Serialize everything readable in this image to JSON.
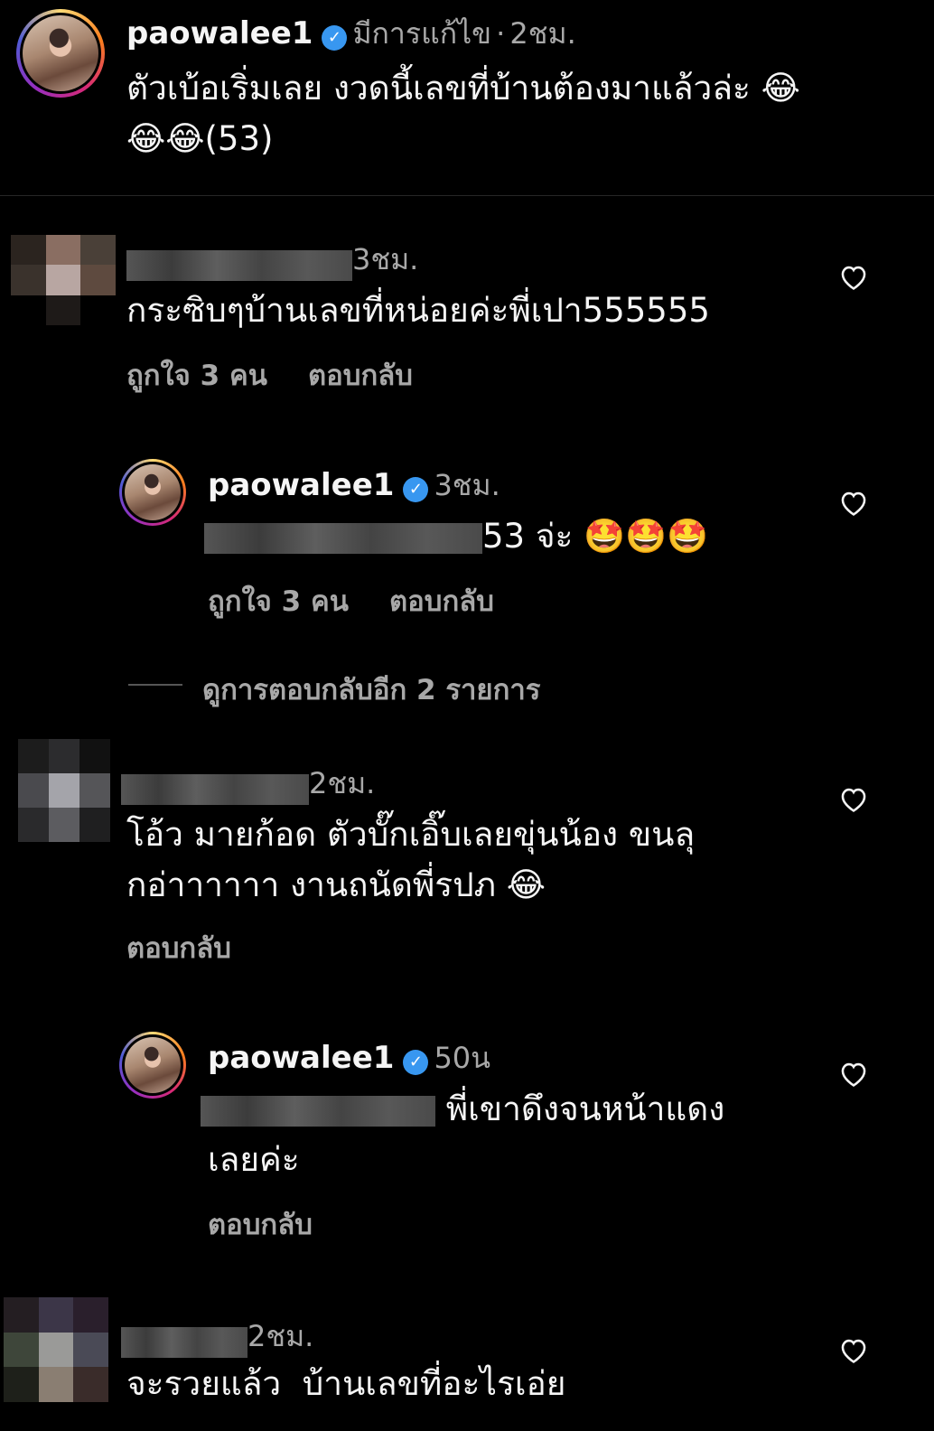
{
  "caption": {
    "username": "paowalee1",
    "verified": true,
    "edited_label": "มีการแก้ไข",
    "separator": "·",
    "time": "2ชม.",
    "text_line1": "ตัวเบ้อเริ่มเลย งวดนี้เลขที่บ้านต้องมาแล้วล่ะ 😂",
    "text_line2": "😂😂(53)"
  },
  "comments": [
    {
      "time": "3ชม.",
      "text": "กระซิบๆบ้านเลขที่หน่อยค่ะพี่เปา555555",
      "likes": "ถูกใจ 3 คน",
      "reply_label": "ตอบกลับ"
    },
    {
      "username": "paowalee1",
      "time": "3ชม.",
      "text": "53 จ่ะ 🤩🤩🤩",
      "likes": "ถูกใจ 3 คน",
      "reply_label": "ตอบกลับ"
    },
    {
      "view_more": "ดูการตอบกลับอีก 2 รายการ"
    },
    {
      "time": "2ชม.",
      "text_line1": "โอ้ว มายก้อด ตัวบั๊กเอิ๊บเลยขุ่นน้อง ขนลุ",
      "text_line2": "กอ่าาาาาา งานถนัดพี่รปภ 😂",
      "reply_label": "ตอบกลับ"
    },
    {
      "username": "paowalee1",
      "time": "50น",
      "text_line1": "พี่เขาดึงจนหน้าแดง",
      "text_line2": "เลยค่ะ",
      "reply_label": "ตอบกลับ"
    },
    {
      "time": "2ชม.",
      "text": "จะรวยแล้ว  บ้านเลขที่อะไรเอ่ย"
    }
  ],
  "icons": {
    "heart": "heart-outline-icon",
    "verified": "verified-badge-icon"
  },
  "colors": {
    "background": "#000000",
    "text": "#f5f5f5",
    "secondary": "#a8a8a8",
    "verified": "#3897f0"
  }
}
